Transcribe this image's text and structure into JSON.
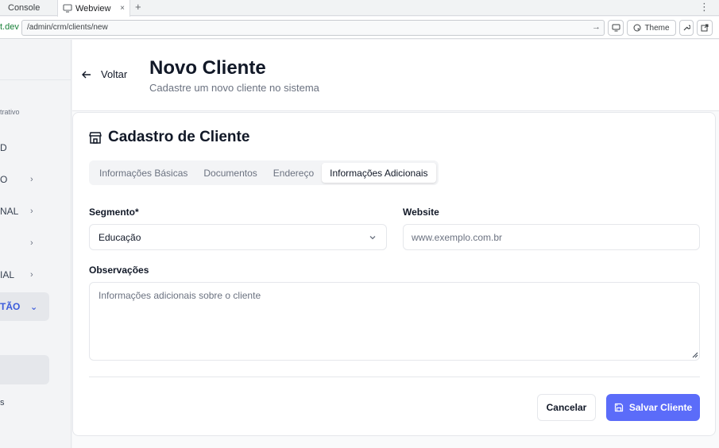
{
  "browser": {
    "tabs": [
      {
        "label": "Console"
      },
      {
        "label": "Webview",
        "close": "×"
      }
    ],
    "add_tab": "+",
    "menu": "⋮",
    "domain_tail": "t.dev",
    "url": "/admin/crm/clients/new",
    "go_icon": "→",
    "theme_label": "Theme"
  },
  "sidebar": {
    "caption": "trativo",
    "items": [
      {
        "label": "D",
        "chevron": ""
      },
      {
        "label": "O",
        "chevron": "›"
      },
      {
        "label": "NAL",
        "chevron": "›"
      },
      {
        "label": "",
        "chevron": "›"
      },
      {
        "label": "IAL",
        "chevron": "›"
      },
      {
        "label": "TÃO",
        "chevron": "⌄"
      }
    ],
    "bottom_label": "s"
  },
  "header": {
    "back_label": "Voltar",
    "title": "Novo Cliente",
    "subtitle": "Cadastre um novo cliente no sistema"
  },
  "card": {
    "title": "Cadastro de Cliente",
    "tabs": [
      {
        "label": "Informações Básicas",
        "active": false
      },
      {
        "label": "Documentos",
        "active": false
      },
      {
        "label": "Endereço",
        "active": false
      },
      {
        "label": "Informações Adicionais",
        "active": true
      }
    ],
    "segment": {
      "label": "Segmento*",
      "value": "Educação"
    },
    "website": {
      "label": "Website",
      "placeholder": "www.exemplo.com.br"
    },
    "notes": {
      "label": "Observações",
      "placeholder": "Informações adicionais sobre o cliente"
    },
    "cancel_label": "Cancelar",
    "save_label": "Salvar Cliente"
  },
  "colors": {
    "accent": "#5b6cf9",
    "sidebar_active": "#3b5bdb"
  }
}
